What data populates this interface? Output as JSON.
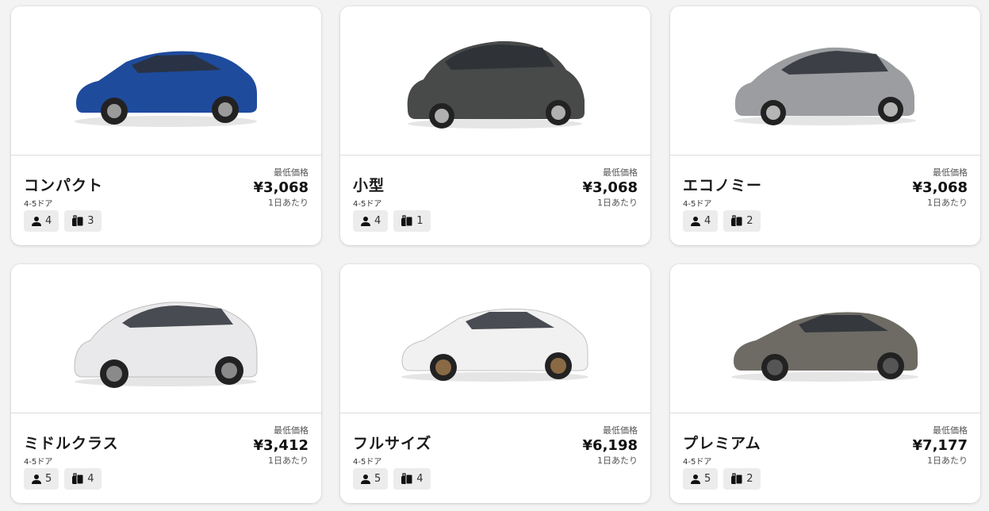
{
  "cards": [
    {
      "name": "コンパクト",
      "doors": "4-5ドア",
      "passengers": "4",
      "luggage": "3",
      "min_label": "最低価格",
      "price": "¥3,068",
      "per_day": "1日あたり",
      "car_color": "#1e4b9c"
    },
    {
      "name": "小型",
      "doors": "4-5ドア",
      "passengers": "4",
      "luggage": "1",
      "min_label": "最低価格",
      "price": "¥3,068",
      "per_day": "1日あたり",
      "car_color": "#474a48"
    },
    {
      "name": "エコノミー",
      "doors": "4-5ドア",
      "passengers": "4",
      "luggage": "2",
      "min_label": "最低価格",
      "price": "¥3,068",
      "per_day": "1日あたり",
      "car_color": "#9b9da0"
    },
    {
      "name": "ミドルクラス",
      "doors": "4-5ドア",
      "passengers": "5",
      "luggage": "4",
      "min_label": "最低価格",
      "price": "¥3,412",
      "per_day": "1日あたり",
      "car_color": "#e9e9eb"
    },
    {
      "name": "フルサイズ",
      "doors": "4-5ドア",
      "passengers": "5",
      "luggage": "4",
      "min_label": "最低価格",
      "price": "¥6,198",
      "per_day": "1日あたり",
      "car_color": "#f1f1f1"
    },
    {
      "name": "プレミアム",
      "doors": "4-5ドア",
      "passengers": "5",
      "luggage": "2",
      "min_label": "最低価格",
      "price": "¥7,177",
      "per_day": "1日あたり",
      "car_color": "#6e6b65"
    }
  ]
}
